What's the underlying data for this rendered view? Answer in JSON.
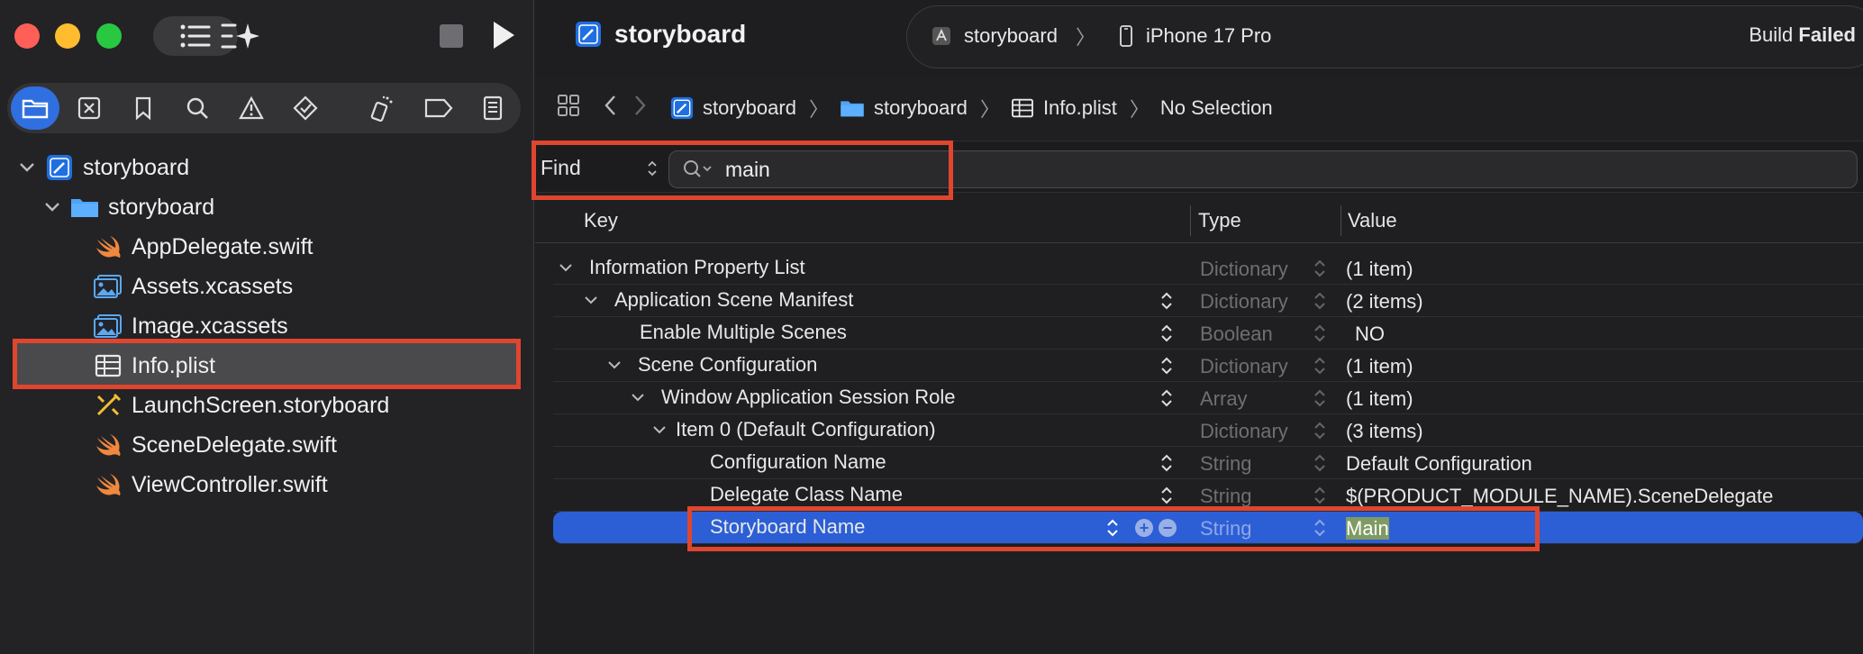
{
  "sidebar": {
    "tree": [
      {
        "label": "storyboard",
        "icon": "project-icon"
      },
      {
        "label": "storyboard",
        "icon": "folder-icon"
      },
      {
        "label": "AppDelegate.swift",
        "icon": "swift-icon"
      },
      {
        "label": "Assets.xcassets",
        "icon": "asset-icon"
      },
      {
        "label": "Image.xcassets",
        "icon": "asset-icon"
      },
      {
        "label": "Info.plist",
        "icon": "plist-icon"
      },
      {
        "label": "LaunchScreen.storyboard",
        "icon": "storyboard-icon"
      },
      {
        "label": "SceneDelegate.swift",
        "icon": "swift-icon"
      },
      {
        "label": "ViewController.swift",
        "icon": "swift-icon"
      }
    ]
  },
  "toolbar": {
    "title": "storyboard",
    "scheme": "storyboard",
    "device": "iPhone 17 Pro",
    "build_prefix": "Build",
    "build_status": "Failed"
  },
  "jumpbar": {
    "items": [
      "storyboard",
      "storyboard",
      "Info.plist",
      "No Selection"
    ]
  },
  "find": {
    "mode": "Find",
    "query": "main"
  },
  "columns": {
    "key": "Key",
    "type": "Type",
    "value": "Value"
  },
  "plist": {
    "rows": [
      {
        "key": "Information Property List",
        "type": "Dictionary",
        "value": "(1 item)"
      },
      {
        "key": "Application Scene Manifest",
        "type": "Dictionary",
        "value": "(2 items)"
      },
      {
        "key": "Enable Multiple Scenes",
        "type": "Boolean",
        "value": "NO"
      },
      {
        "key": "Scene Configuration",
        "type": "Dictionary",
        "value": "(1 item)"
      },
      {
        "key": "Window Application Session Role",
        "type": "Array",
        "value": "(1 item)"
      },
      {
        "key": "Item 0 (Default Configuration)",
        "type": "Dictionary",
        "value": "(3 items)"
      },
      {
        "key": "Configuration Name",
        "type": "String",
        "value": "Default Configuration"
      },
      {
        "key": "Delegate Class Name",
        "type": "String",
        "value": "$(PRODUCT_MODULE_NAME).SceneDelegate"
      },
      {
        "key": "Storyboard Name",
        "type": "String",
        "value": "Main"
      }
    ]
  },
  "colors": {
    "accent": "#2f6fe0",
    "selection": "#2c5fd6",
    "highlight_box": "#e0452e",
    "swift": "#f0883e"
  }
}
